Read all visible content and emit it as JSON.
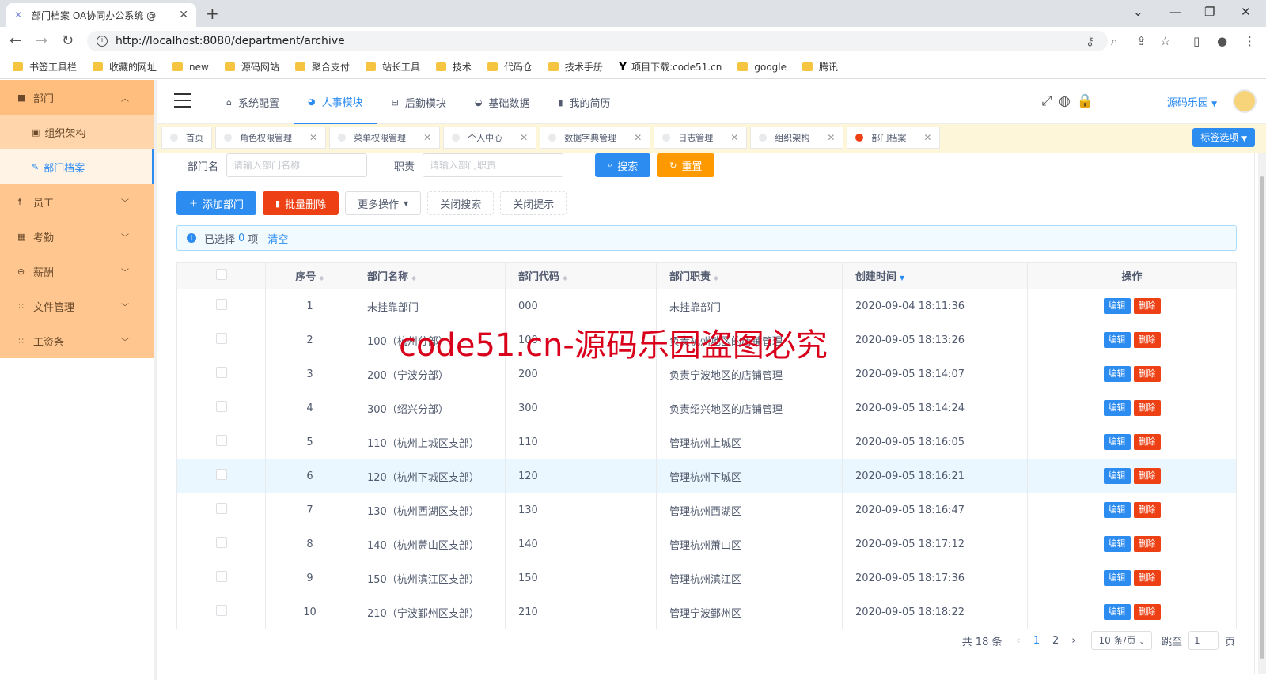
{
  "browser": {
    "tab_title": "部门档案 OA协同办公系统 @",
    "tab_icon": "sparkle-icon",
    "url": "http://localhost:8080/department/archive",
    "bookmarks": [
      "书签工具栏",
      "收藏的网址",
      "new",
      "源码网站",
      "聚合支付",
      "站长工具",
      "技术",
      "代码仓",
      "技术手册",
      "项目下载:code51.cn",
      "google",
      "腾讯"
    ]
  },
  "sidebar": {
    "items": [
      {
        "label": "部门",
        "icon": "grid-icon",
        "open": true
      },
      {
        "label": "组织架构",
        "icon": "building-icon"
      },
      {
        "label": "部门档案",
        "icon": "pencil-icon",
        "active": true
      },
      {
        "label": "员工",
        "icon": "person-icon"
      },
      {
        "label": "考勤",
        "icon": "calendar-icon"
      },
      {
        "label": "薪酬",
        "icon": "wallet-icon"
      },
      {
        "label": "文件管理",
        "icon": "apps-icon"
      },
      {
        "label": "工资条",
        "icon": "apps-icon"
      }
    ]
  },
  "header": {
    "nav": [
      {
        "label": "系统配置",
        "icon": "home-icon"
      },
      {
        "label": "人事模块",
        "icon": "pie-icon",
        "active": true
      },
      {
        "label": "后勤模块",
        "icon": "cart-icon"
      },
      {
        "label": "基础数据",
        "icon": "chart-icon"
      },
      {
        "label": "我的简历",
        "icon": "book-icon"
      }
    ],
    "user": "源码乐园"
  },
  "tags": {
    "items": [
      "首页",
      "角色权限管理",
      "菜单权限管理",
      "个人中心",
      "数据字典管理",
      "日志管理",
      "组织架构",
      "部门档案"
    ],
    "options_label": "标签选项"
  },
  "search": {
    "name_label": "部门名",
    "name_placeholder": "请输入部门名称",
    "duty_label": "职责",
    "duty_placeholder": "请输入部门职责",
    "search_btn": "搜索",
    "reset_btn": "重置"
  },
  "toolbar": {
    "add": "添加部门",
    "batch_delete": "批量删除",
    "more": "更多操作",
    "close_search": "关闭搜索",
    "close_tip": "关闭提示"
  },
  "alert": {
    "prefix": "已选择",
    "count": "0",
    "suffix": "项",
    "clear": "清空"
  },
  "table": {
    "columns": [
      "序号",
      "部门名称",
      "部门代码",
      "部门职责",
      "创建时间",
      "操作"
    ],
    "edit": "编辑",
    "delete": "删除",
    "rows": [
      {
        "no": "1",
        "name": "未挂靠部门",
        "code": "000",
        "duty": "未挂靠部门",
        "time": "2020-09-04 18:11:36"
      },
      {
        "no": "2",
        "name": "100（杭州分部）",
        "code": "100",
        "duty": "负责杭州地区的店铺管理",
        "time": "2020-09-05 18:13:26"
      },
      {
        "no": "3",
        "name": "200（宁波分部）",
        "code": "200",
        "duty": "负责宁波地区的店铺管理",
        "time": "2020-09-05 18:14:07"
      },
      {
        "no": "4",
        "name": "300（绍兴分部）",
        "code": "300",
        "duty": "负责绍兴地区的店铺管理",
        "time": "2020-09-05 18:14:24"
      },
      {
        "no": "5",
        "name": "110（杭州上城区支部）",
        "code": "110",
        "duty": "管理杭州上城区",
        "time": "2020-09-05 18:16:05"
      },
      {
        "no": "6",
        "name": "120（杭州下城区支部）",
        "code": "120",
        "duty": "管理杭州下城区",
        "time": "2020-09-05 18:16:21"
      },
      {
        "no": "7",
        "name": "130（杭州西湖区支部）",
        "code": "130",
        "duty": "管理杭州西湖区",
        "time": "2020-09-05 18:16:47"
      },
      {
        "no": "8",
        "name": "140（杭州萧山区支部）",
        "code": "140",
        "duty": "管理杭州萧山区",
        "time": "2020-09-05 18:17:12"
      },
      {
        "no": "9",
        "name": "150（杭州滨江区支部）",
        "code": "150",
        "duty": "管理杭州滨江区",
        "time": "2020-09-05 18:17:36"
      },
      {
        "no": "10",
        "name": "210（宁波鄞州区支部）",
        "code": "210",
        "duty": "管理宁波鄞州区",
        "time": "2020-09-05 18:18:22"
      }
    ]
  },
  "pager": {
    "total": "共 18 条",
    "pages": [
      "1",
      "2"
    ],
    "size": "10 条/页",
    "jump_label": "跳至",
    "jump_value": "1",
    "page_suffix": "页"
  },
  "watermark": "code51.cn-源码乐园盗图必究",
  "colors": {
    "primary": "#2d8cf0",
    "danger": "#ed4014",
    "warning": "#ff9900",
    "sidebar": "#ffc78f"
  }
}
